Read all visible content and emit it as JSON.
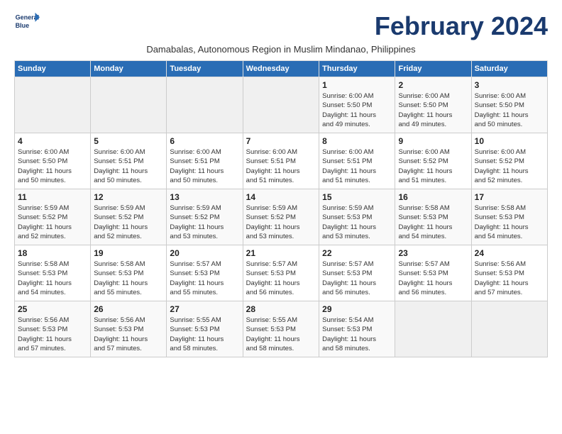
{
  "header": {
    "logo_line1": "General",
    "logo_line2": "Blue",
    "month_title": "February 2024",
    "subtitle": "Damabalas, Autonomous Region in Muslim Mindanao, Philippines"
  },
  "days_of_week": [
    "Sunday",
    "Monday",
    "Tuesday",
    "Wednesday",
    "Thursday",
    "Friday",
    "Saturday"
  ],
  "weeks": [
    [
      {
        "day": "",
        "info": ""
      },
      {
        "day": "",
        "info": ""
      },
      {
        "day": "",
        "info": ""
      },
      {
        "day": "",
        "info": ""
      },
      {
        "day": "1",
        "info": "Sunrise: 6:00 AM\nSunset: 5:50 PM\nDaylight: 11 hours\nand 49 minutes."
      },
      {
        "day": "2",
        "info": "Sunrise: 6:00 AM\nSunset: 5:50 PM\nDaylight: 11 hours\nand 49 minutes."
      },
      {
        "day": "3",
        "info": "Sunrise: 6:00 AM\nSunset: 5:50 PM\nDaylight: 11 hours\nand 50 minutes."
      }
    ],
    [
      {
        "day": "4",
        "info": "Sunrise: 6:00 AM\nSunset: 5:50 PM\nDaylight: 11 hours\nand 50 minutes."
      },
      {
        "day": "5",
        "info": "Sunrise: 6:00 AM\nSunset: 5:51 PM\nDaylight: 11 hours\nand 50 minutes."
      },
      {
        "day": "6",
        "info": "Sunrise: 6:00 AM\nSunset: 5:51 PM\nDaylight: 11 hours\nand 50 minutes."
      },
      {
        "day": "7",
        "info": "Sunrise: 6:00 AM\nSunset: 5:51 PM\nDaylight: 11 hours\nand 51 minutes."
      },
      {
        "day": "8",
        "info": "Sunrise: 6:00 AM\nSunset: 5:51 PM\nDaylight: 11 hours\nand 51 minutes."
      },
      {
        "day": "9",
        "info": "Sunrise: 6:00 AM\nSunset: 5:52 PM\nDaylight: 11 hours\nand 51 minutes."
      },
      {
        "day": "10",
        "info": "Sunrise: 6:00 AM\nSunset: 5:52 PM\nDaylight: 11 hours\nand 52 minutes."
      }
    ],
    [
      {
        "day": "11",
        "info": "Sunrise: 5:59 AM\nSunset: 5:52 PM\nDaylight: 11 hours\nand 52 minutes."
      },
      {
        "day": "12",
        "info": "Sunrise: 5:59 AM\nSunset: 5:52 PM\nDaylight: 11 hours\nand 52 minutes."
      },
      {
        "day": "13",
        "info": "Sunrise: 5:59 AM\nSunset: 5:52 PM\nDaylight: 11 hours\nand 53 minutes."
      },
      {
        "day": "14",
        "info": "Sunrise: 5:59 AM\nSunset: 5:52 PM\nDaylight: 11 hours\nand 53 minutes."
      },
      {
        "day": "15",
        "info": "Sunrise: 5:59 AM\nSunset: 5:53 PM\nDaylight: 11 hours\nand 53 minutes."
      },
      {
        "day": "16",
        "info": "Sunrise: 5:58 AM\nSunset: 5:53 PM\nDaylight: 11 hours\nand 54 minutes."
      },
      {
        "day": "17",
        "info": "Sunrise: 5:58 AM\nSunset: 5:53 PM\nDaylight: 11 hours\nand 54 minutes."
      }
    ],
    [
      {
        "day": "18",
        "info": "Sunrise: 5:58 AM\nSunset: 5:53 PM\nDaylight: 11 hours\nand 54 minutes."
      },
      {
        "day": "19",
        "info": "Sunrise: 5:58 AM\nSunset: 5:53 PM\nDaylight: 11 hours\nand 55 minutes."
      },
      {
        "day": "20",
        "info": "Sunrise: 5:57 AM\nSunset: 5:53 PM\nDaylight: 11 hours\nand 55 minutes."
      },
      {
        "day": "21",
        "info": "Sunrise: 5:57 AM\nSunset: 5:53 PM\nDaylight: 11 hours\nand 56 minutes."
      },
      {
        "day": "22",
        "info": "Sunrise: 5:57 AM\nSunset: 5:53 PM\nDaylight: 11 hours\nand 56 minutes."
      },
      {
        "day": "23",
        "info": "Sunrise: 5:57 AM\nSunset: 5:53 PM\nDaylight: 11 hours\nand 56 minutes."
      },
      {
        "day": "24",
        "info": "Sunrise: 5:56 AM\nSunset: 5:53 PM\nDaylight: 11 hours\nand 57 minutes."
      }
    ],
    [
      {
        "day": "25",
        "info": "Sunrise: 5:56 AM\nSunset: 5:53 PM\nDaylight: 11 hours\nand 57 minutes."
      },
      {
        "day": "26",
        "info": "Sunrise: 5:56 AM\nSunset: 5:53 PM\nDaylight: 11 hours\nand 57 minutes."
      },
      {
        "day": "27",
        "info": "Sunrise: 5:55 AM\nSunset: 5:53 PM\nDaylight: 11 hours\nand 58 minutes."
      },
      {
        "day": "28",
        "info": "Sunrise: 5:55 AM\nSunset: 5:53 PM\nDaylight: 11 hours\nand 58 minutes."
      },
      {
        "day": "29",
        "info": "Sunrise: 5:54 AM\nSunset: 5:53 PM\nDaylight: 11 hours\nand 58 minutes."
      },
      {
        "day": "",
        "info": ""
      },
      {
        "day": "",
        "info": ""
      }
    ]
  ]
}
